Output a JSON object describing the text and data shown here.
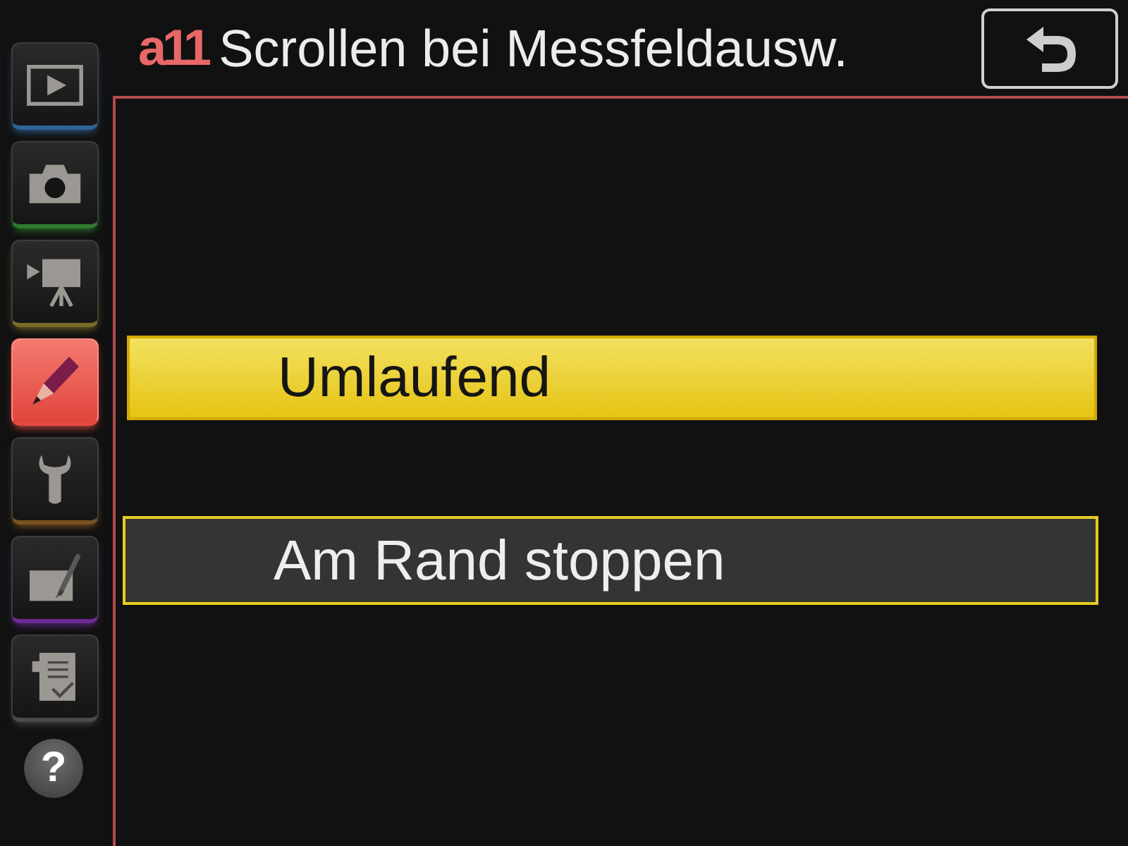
{
  "sidebar": {
    "tabs": [
      {
        "kind": "playback",
        "color": "#2f6396",
        "selected": false
      },
      {
        "kind": "shooting",
        "color": "#2f7a2f",
        "selected": false
      },
      {
        "kind": "movie",
        "color": "#7a6a2a",
        "selected": false
      },
      {
        "kind": "custom",
        "color": "#e04a40",
        "selected": true
      },
      {
        "kind": "setup",
        "color": "#7a5220",
        "selected": false
      },
      {
        "kind": "retouch",
        "color": "#6a2a90",
        "selected": false
      },
      {
        "kind": "mymenu",
        "color": "#4a4a4a",
        "selected": false
      }
    ],
    "help": {
      "label": "?"
    }
  },
  "header": {
    "code": "a11",
    "title": "Scrollen bei Messfeldausw."
  },
  "options": [
    {
      "label": "Umlaufend",
      "selected": true
    },
    {
      "label": "Am Rand stoppen",
      "selected": false
    }
  ]
}
